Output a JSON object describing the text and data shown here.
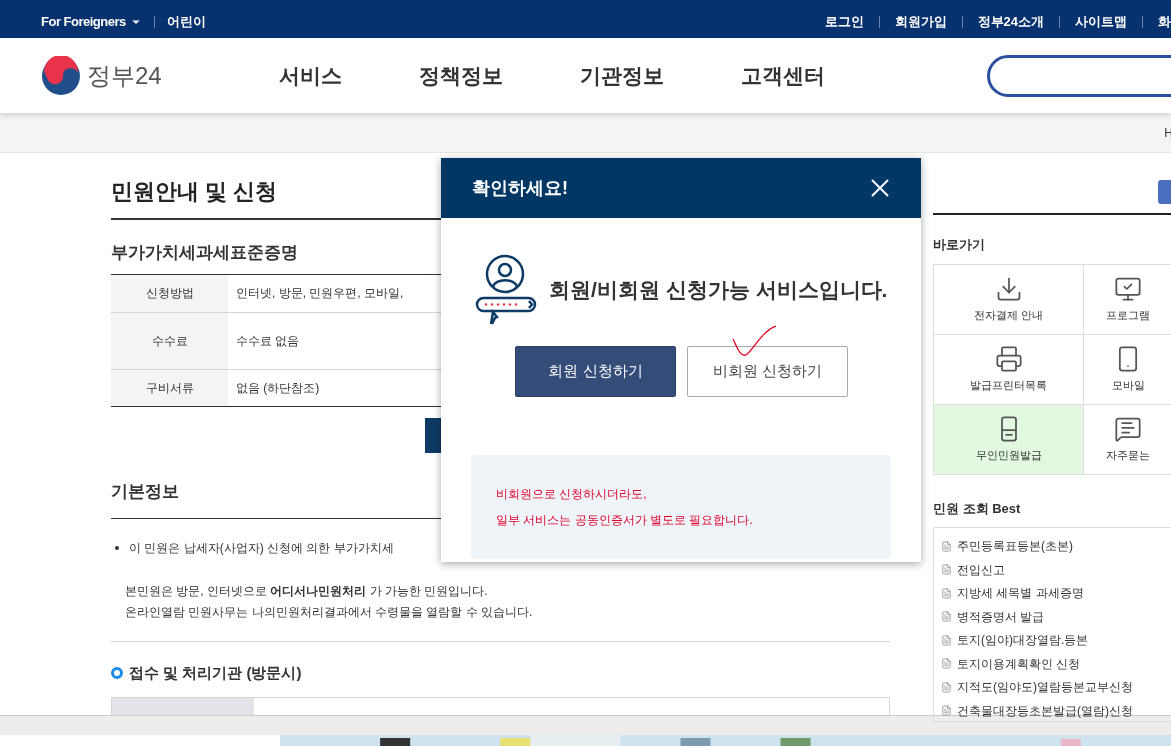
{
  "top_bar": {
    "language_menu": "For Foreigners",
    "left_links": [
      "어린이"
    ],
    "right_links": [
      "로그인",
      "회원가입",
      "정부24소개",
      "사이트맵",
      "화"
    ]
  },
  "header": {
    "logo": "정부24",
    "nav": [
      "서비스",
      "정책정보",
      "기관정보",
      "고객센터"
    ]
  },
  "breadcrumb": "H",
  "page": {
    "title": "민원안내 및 신청",
    "service_name": "부가가치세과세표준증명",
    "info_rows": [
      {
        "label": "신청방법",
        "value": "인터넷, 방문, 민원우편, 모바일,"
      },
      {
        "label": "수수료",
        "value": "수수료 없음"
      },
      {
        "label": "구비서류",
        "value": "없음 (하단참조)"
      }
    ],
    "section_title": "기본정보",
    "bullet": "이 민원은 납세자(사업자) 신청에 의한 부가가치세",
    "paragraph": [
      "본민원은 방문, 인터넷으로 **어디서나민원처리** 가 가능한 민원입니다.",
      "온라인열람 민원사무는 나의민원처리결과에서 수령물을 열람할 수 있습니다."
    ],
    "agency_heading": "접수 및 처리기관 (방문시)"
  },
  "sidebar": {
    "shortcuts_title": "바로가기",
    "shortcuts": [
      {
        "label": "전자결제 안내",
        "kind": "download",
        "selected": false
      },
      {
        "label": "프로그램",
        "kind": "monitor",
        "selected": false
      },
      {
        "label": "발급프린터목록",
        "kind": "printer",
        "selected": false
      },
      {
        "label": "모바일",
        "kind": "phone",
        "selected": false
      },
      {
        "label": "무인민원발급",
        "kind": "kiosk",
        "selected": true
      },
      {
        "label": "자주묻는",
        "kind": "chat",
        "selected": false
      }
    ],
    "best_title": "민원 조회 Best",
    "best_items": [
      "주민등록표등본(초본)",
      "전입신고",
      "지방세 세목별 과세증명",
      "병적증명서 발급",
      "토지(임야)대장열람.등본",
      "토지이용계획확인 신청",
      "지적도(임야도)열람등본교부신청",
      "건축물대장등초본발급(열람)신청"
    ]
  },
  "modal": {
    "title": "확인하세요!",
    "message": "회원/비회원 신청가능 서비스입니다.",
    "buttons": [
      {
        "label": "회원 신청하기",
        "kind": "primary"
      },
      {
        "label": "비회원 신청하기",
        "kind": "secondary"
      }
    ],
    "notice": [
      "비회원으로 신청하시더라도,",
      "일부 서비스는 공동인증서가 별도로 필요합니다."
    ]
  }
}
